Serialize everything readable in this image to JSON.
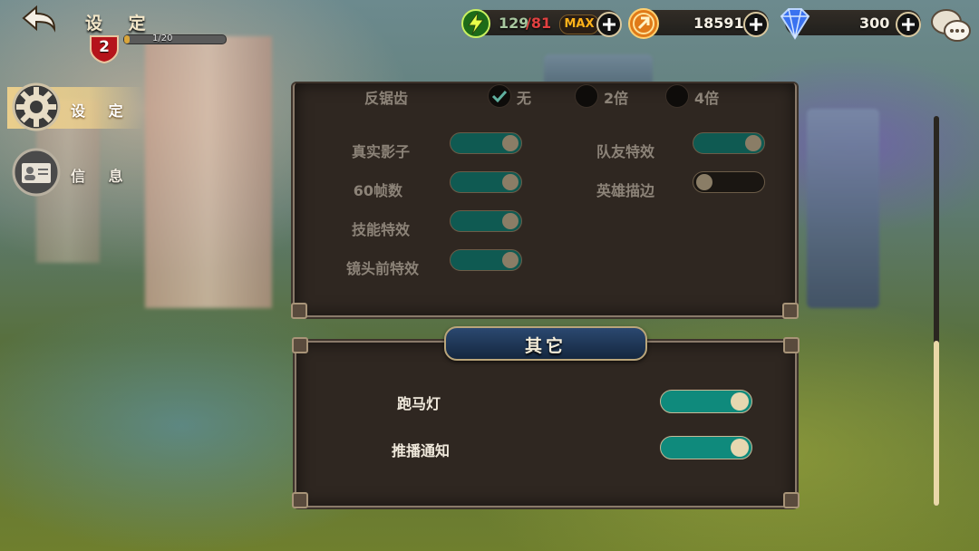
{
  "header": {
    "title": "设 定",
    "level": "2",
    "xp_text": "1/20",
    "xp_progress": 0.05
  },
  "resources": {
    "stamina_current": "129",
    "stamina_max": "/81",
    "max_label": "MAX",
    "gold": "18591",
    "diamonds": "300"
  },
  "nav": {
    "items": [
      {
        "label": "设 定",
        "icon": "gear-icon",
        "active": true
      },
      {
        "label": "信 息",
        "icon": "profile-card-icon",
        "active": false
      }
    ]
  },
  "graphics": {
    "antialias_label": "反锯齿",
    "antialias_options": [
      "无",
      "2倍",
      "4倍"
    ],
    "antialias_selected": "无",
    "settings_left": [
      {
        "label": "真实影子",
        "on": true
      },
      {
        "label": "60帧数",
        "on": true
      },
      {
        "label": "技能特效",
        "on": true
      },
      {
        "label": "镜头前特效",
        "on": true
      }
    ],
    "settings_right": [
      {
        "label": "队友特效",
        "on": true
      },
      {
        "label": "英雄描边",
        "on": false
      }
    ]
  },
  "other": {
    "title": "其它",
    "settings": [
      {
        "label": "跑马灯",
        "on": true
      },
      {
        "label": "推播通知",
        "on": true
      }
    ]
  },
  "colors": {
    "toggle_on": "#0f8a7c",
    "toggle_off": "#1a1612",
    "panel_bg": "#2f2721",
    "banner_blue": "#2b4870",
    "gold_text": "#ffb21a"
  }
}
